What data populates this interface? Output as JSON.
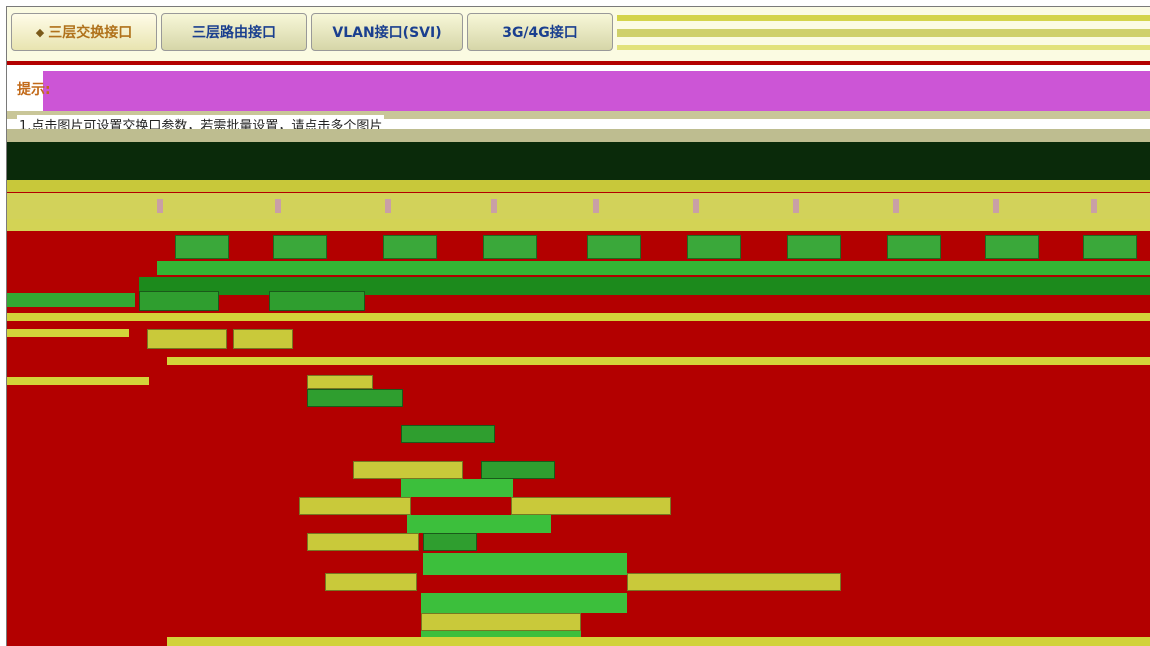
{
  "tabs": [
    {
      "label": "三层交换接口",
      "active": true
    },
    {
      "label": "三层路由接口",
      "active": false
    },
    {
      "label": "VLAN接口(SVI)",
      "active": false
    },
    {
      "label": "3G/4G接口",
      "active": false
    }
  ],
  "notice": {
    "title": "提示:",
    "line1": "1.点击图片可设置交换口参数，若需批量设置，请点击多个图片"
  },
  "colors": {
    "background": "#b30000",
    "magenta": "#cc55d6",
    "green": "#34b534",
    "yellow": "#d3d33a"
  }
}
